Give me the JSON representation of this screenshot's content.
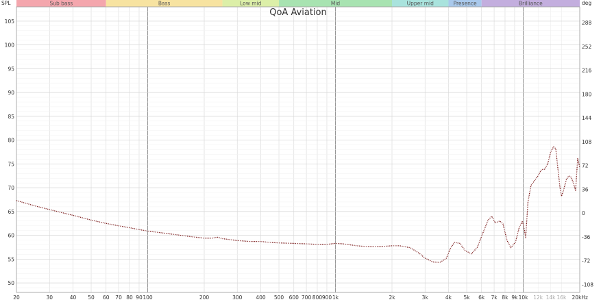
{
  "chart_data": {
    "type": "line",
    "title": "QoA Aviation",
    "ylabel": "SPL",
    "y2label": "deg",
    "x_scale": "log",
    "xlim": [
      20,
      20000
    ],
    "ylim": [
      48,
      108
    ],
    "y2lim": [
      -120,
      312
    ],
    "grid": true,
    "x_major_ticks": [
      {
        "v": 20,
        "l": "20"
      },
      {
        "v": 30,
        "l": "30"
      },
      {
        "v": 40,
        "l": "40"
      },
      {
        "v": 50,
        "l": "50"
      },
      {
        "v": 60,
        "l": "60"
      },
      {
        "v": 70,
        "l": "70"
      },
      {
        "v": 80,
        "l": "80"
      },
      {
        "v": 90,
        "l": "90"
      },
      {
        "v": 100,
        "l": "100"
      },
      {
        "v": 200,
        "l": "200"
      },
      {
        "v": 300,
        "l": "300"
      },
      {
        "v": 400,
        "l": "400"
      },
      {
        "v": 500,
        "l": "500"
      },
      {
        "v": 600,
        "l": "600"
      },
      {
        "v": 700,
        "l": "700"
      },
      {
        "v": 800,
        "l": "800"
      },
      {
        "v": 900,
        "l": "900"
      },
      {
        "v": 1000,
        "l": "1k"
      },
      {
        "v": 2000,
        "l": "2k"
      },
      {
        "v": 3000,
        "l": "3k"
      },
      {
        "v": 4000,
        "l": "4k"
      },
      {
        "v": 5000,
        "l": "5k"
      },
      {
        "v": 6000,
        "l": "6k"
      },
      {
        "v": 7000,
        "l": "7k"
      },
      {
        "v": 8000,
        "l": "8k"
      },
      {
        "v": 9000,
        "l": "9k"
      },
      {
        "v": 10000,
        "l": "10k"
      },
      {
        "v": 20000,
        "l": "20kHz"
      }
    ],
    "x_minor_ticks": [
      {
        "v": 12000,
        "l": "12k"
      },
      {
        "v": 14000,
        "l": "14k"
      },
      {
        "v": 16000,
        "l": "16k"
      }
    ],
    "y_ticks": [
      50,
      55,
      60,
      65,
      70,
      75,
      80,
      85,
      90,
      95,
      100,
      105
    ],
    "y2_ticks": [
      -108,
      -72,
      -36,
      0,
      36,
      72,
      108,
      144,
      180,
      216,
      252,
      288
    ],
    "bands": [
      {
        "name": "Sub bass",
        "from": 20,
        "to": 60,
        "color": "#f4a6ad"
      },
      {
        "name": "Bass",
        "from": 60,
        "to": 250,
        "color": "#f7e3a1"
      },
      {
        "name": "Low mid",
        "from": 250,
        "to": 500,
        "color": "#dcefa8"
      },
      {
        "name": "Mid",
        "from": 500,
        "to": 2000,
        "color": "#a8e3b1"
      },
      {
        "name": "Upper mid",
        "from": 2000,
        "to": 4000,
        "color": "#a9e3dd"
      },
      {
        "name": "Presence",
        "from": 4000,
        "to": 6000,
        "color": "#a9c9ec"
      },
      {
        "name": "Brilliance",
        "from": 6000,
        "to": 20000,
        "color": "#c3aede"
      }
    ],
    "series": [
      {
        "color": "#7a1a1a",
        "points": [
          [
            20,
            67.3
          ],
          [
            25,
            66.2
          ],
          [
            30,
            65.4
          ],
          [
            40,
            64.2
          ],
          [
            50,
            63.2
          ],
          [
            60,
            62.5
          ],
          [
            70,
            62.0
          ],
          [
            80,
            61.6
          ],
          [
            90,
            61.2
          ],
          [
            100,
            60.9
          ],
          [
            120,
            60.5
          ],
          [
            150,
            60.0
          ],
          [
            180,
            59.6
          ],
          [
            200,
            59.4
          ],
          [
            220,
            59.4
          ],
          [
            235,
            59.6
          ],
          [
            250,
            59.3
          ],
          [
            300,
            58.9
          ],
          [
            350,
            58.7
          ],
          [
            400,
            58.7
          ],
          [
            450,
            58.5
          ],
          [
            500,
            58.4
          ],
          [
            600,
            58.3
          ],
          [
            700,
            58.2
          ],
          [
            800,
            58.1
          ],
          [
            900,
            58.1
          ],
          [
            1000,
            58.3
          ],
          [
            1100,
            58.2
          ],
          [
            1300,
            57.8
          ],
          [
            1500,
            57.6
          ],
          [
            1700,
            57.6
          ],
          [
            2000,
            57.8
          ],
          [
            2200,
            57.8
          ],
          [
            2500,
            57.4
          ],
          [
            2800,
            56.2
          ],
          [
            3000,
            55.2
          ],
          [
            3300,
            54.4
          ],
          [
            3600,
            54.3
          ],
          [
            3900,
            55.2
          ],
          [
            4100,
            57.3
          ],
          [
            4300,
            58.5
          ],
          [
            4600,
            58.3
          ],
          [
            4900,
            56.8
          ],
          [
            5300,
            56.1
          ],
          [
            5700,
            57.5
          ],
          [
            6100,
            60.5
          ],
          [
            6500,
            63.2
          ],
          [
            6800,
            64.0
          ],
          [
            7100,
            62.6
          ],
          [
            7500,
            63.0
          ],
          [
            7800,
            62.4
          ],
          [
            8200,
            58.9
          ],
          [
            8600,
            57.4
          ],
          [
            9100,
            58.6
          ],
          [
            9500,
            61.5
          ],
          [
            9900,
            63.0
          ],
          [
            10100,
            61.5
          ],
          [
            10300,
            59.5
          ],
          [
            10600,
            67.0
          ],
          [
            11000,
            70.5
          ],
          [
            11500,
            71.5
          ],
          [
            12000,
            72.5
          ],
          [
            12500,
            73.8
          ],
          [
            13000,
            73.9
          ],
          [
            13500,
            75.0
          ],
          [
            14000,
            77.5
          ],
          [
            14500,
            78.6
          ],
          [
            14900,
            78.2
          ],
          [
            15300,
            74.0
          ],
          [
            15700,
            70.0
          ],
          [
            16000,
            68.2
          ],
          [
            16400,
            69.5
          ],
          [
            17000,
            71.8
          ],
          [
            17500,
            72.5
          ],
          [
            18000,
            72.2
          ],
          [
            18500,
            71.0
          ],
          [
            19000,
            69.4
          ],
          [
            19500,
            76.2
          ],
          [
            20000,
            74.2
          ]
        ]
      }
    ]
  }
}
